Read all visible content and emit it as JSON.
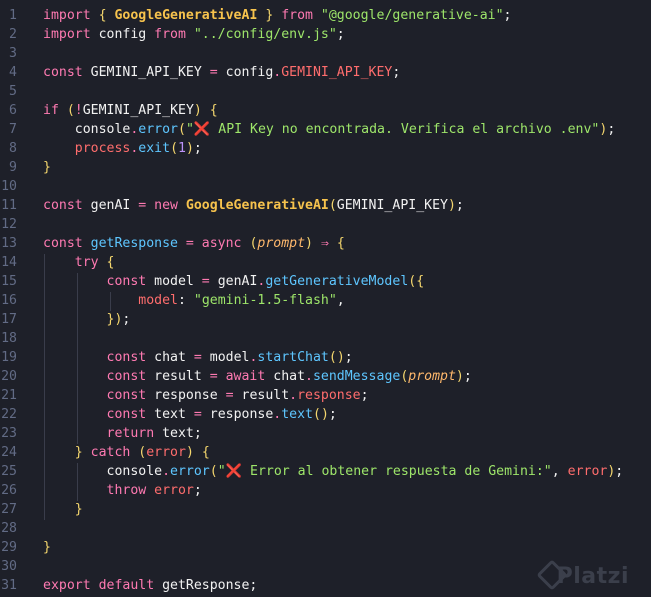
{
  "editor": {
    "line_numbers": [
      "1",
      "2",
      "3",
      "4",
      "5",
      "6",
      "7",
      "8",
      "9",
      "10",
      "11",
      "12",
      "13",
      "14",
      "15",
      "16",
      "17",
      "18",
      "19",
      "20",
      "21",
      "22",
      "23",
      "24",
      "25",
      "26",
      "27",
      "28",
      "29",
      "30",
      "31"
    ],
    "lines": [
      [
        [
          "kw",
          "import "
        ],
        [
          "punc",
          "{ "
        ],
        [
          "cls",
          "GoogleGenerativeAI"
        ],
        [
          "punc",
          " }"
        ],
        [
          "kw",
          " from "
        ],
        [
          "str",
          "\"@google/generative-ai\""
        ],
        [
          "plain",
          ";"
        ]
      ],
      [
        [
          "kw",
          "import "
        ],
        [
          "plain",
          "config "
        ],
        [
          "kw",
          "from "
        ],
        [
          "str",
          "\"../config/env.js\""
        ],
        [
          "plain",
          ";"
        ]
      ],
      [],
      [
        [
          "kw",
          "const "
        ],
        [
          "plain",
          "GEMINI_API_KEY "
        ],
        [
          "kw",
          "= "
        ],
        [
          "plain",
          "config"
        ],
        [
          "kw",
          "."
        ],
        [
          "prop",
          "GEMINI_API_KEY"
        ],
        [
          "plain",
          ";"
        ]
      ],
      [],
      [
        [
          "kw",
          "if "
        ],
        [
          "punc",
          "("
        ],
        [
          "kw",
          "!"
        ],
        [
          "plain",
          "GEMINI_API_KEY"
        ],
        [
          "punc",
          ") {"
        ]
      ],
      [
        [
          "plain",
          "    console"
        ],
        [
          "kw",
          "."
        ],
        [
          "fn",
          "error"
        ],
        [
          "punc",
          "("
        ],
        [
          "str",
          "\""
        ],
        [
          "x",
          "❌"
        ],
        [
          "str",
          " API Key no encontrada. Verifica el archivo .env\""
        ],
        [
          "punc",
          ")"
        ],
        [
          "plain",
          ";"
        ]
      ],
      [
        [
          "plain",
          "    "
        ],
        [
          "prop",
          "process"
        ],
        [
          "kw",
          "."
        ],
        [
          "fn",
          "exit"
        ],
        [
          "punc",
          "("
        ],
        [
          "num",
          "1"
        ],
        [
          "punc",
          ")"
        ],
        [
          "plain",
          ";"
        ]
      ],
      [
        [
          "punc",
          "}"
        ]
      ],
      [],
      [
        [
          "kw",
          "const "
        ],
        [
          "plain",
          "genAI "
        ],
        [
          "kw",
          "= new "
        ],
        [
          "cls",
          "GoogleGenerativeAI"
        ],
        [
          "punc",
          "("
        ],
        [
          "plain",
          "GEMINI_API_KEY"
        ],
        [
          "punc",
          ")"
        ],
        [
          "plain",
          ";"
        ]
      ],
      [],
      [
        [
          "kw",
          "const "
        ],
        [
          "fn",
          "getResponse "
        ],
        [
          "kw",
          "= async "
        ],
        [
          "punc",
          "("
        ],
        [
          "param",
          "prompt"
        ],
        [
          "punc",
          ") "
        ],
        [
          "kw",
          "⇒ "
        ],
        [
          "punc",
          "{"
        ]
      ],
      [
        [
          "kw",
          "    try "
        ],
        [
          "punc",
          "{"
        ]
      ],
      [
        [
          "kw",
          "        const "
        ],
        [
          "plain",
          "model "
        ],
        [
          "kw",
          "= "
        ],
        [
          "plain",
          "genAI"
        ],
        [
          "kw",
          "."
        ],
        [
          "fn",
          "getGenerativeModel"
        ],
        [
          "punc",
          "({"
        ]
      ],
      [
        [
          "plain",
          "            "
        ],
        [
          "prop",
          "model"
        ],
        [
          "plain",
          ": "
        ],
        [
          "str",
          "\"gemini-1.5-flash\""
        ],
        [
          "plain",
          ","
        ]
      ],
      [
        [
          "plain",
          "        "
        ],
        [
          "punc",
          "})"
        ],
        [
          "plain",
          ";"
        ]
      ],
      [],
      [
        [
          "kw",
          "        const "
        ],
        [
          "plain",
          "chat "
        ],
        [
          "kw",
          "= "
        ],
        [
          "plain",
          "model"
        ],
        [
          "kw",
          "."
        ],
        [
          "fn",
          "startChat"
        ],
        [
          "punc",
          "()"
        ],
        [
          "plain",
          ";"
        ]
      ],
      [
        [
          "kw",
          "        const "
        ],
        [
          "plain",
          "result "
        ],
        [
          "kw",
          "= await "
        ],
        [
          "plain",
          "chat"
        ],
        [
          "kw",
          "."
        ],
        [
          "fn",
          "sendMessage"
        ],
        [
          "punc",
          "("
        ],
        [
          "param",
          "prompt"
        ],
        [
          "punc",
          ")"
        ],
        [
          "plain",
          ";"
        ]
      ],
      [
        [
          "kw",
          "        const "
        ],
        [
          "plain",
          "response "
        ],
        [
          "kw",
          "= "
        ],
        [
          "plain",
          "result"
        ],
        [
          "kw",
          "."
        ],
        [
          "prop",
          "response"
        ],
        [
          "plain",
          ";"
        ]
      ],
      [
        [
          "kw",
          "        const "
        ],
        [
          "plain",
          "text "
        ],
        [
          "kw",
          "= "
        ],
        [
          "plain",
          "response"
        ],
        [
          "kw",
          "."
        ],
        [
          "fn",
          "text"
        ],
        [
          "punc",
          "()"
        ],
        [
          "plain",
          ";"
        ]
      ],
      [
        [
          "kw",
          "        return "
        ],
        [
          "plain",
          "text;"
        ]
      ],
      [
        [
          "punc",
          "    } "
        ],
        [
          "kw",
          "catch "
        ],
        [
          "punc",
          "("
        ],
        [
          "prop",
          "error"
        ],
        [
          "punc",
          ") {"
        ]
      ],
      [
        [
          "plain",
          "        console"
        ],
        [
          "kw",
          "."
        ],
        [
          "fn",
          "error"
        ],
        [
          "punc",
          "("
        ],
        [
          "str",
          "\""
        ],
        [
          "x",
          "❌"
        ],
        [
          "str",
          " Error al obtener respuesta de Gemini:\""
        ],
        [
          "plain",
          ", "
        ],
        [
          "prop",
          "error"
        ],
        [
          "punc",
          ")"
        ],
        [
          "plain",
          ";"
        ]
      ],
      [
        [
          "kw",
          "        throw "
        ],
        [
          "prop",
          "error"
        ],
        [
          "plain",
          ";"
        ]
      ],
      [
        [
          "punc",
          "    }"
        ]
      ],
      [],
      [
        [
          "punc",
          "}"
        ]
      ],
      [],
      [
        [
          "kw",
          "export default "
        ],
        [
          "plain",
          "getResponse;"
        ]
      ]
    ]
  },
  "watermark": {
    "text": "Platzi"
  }
}
